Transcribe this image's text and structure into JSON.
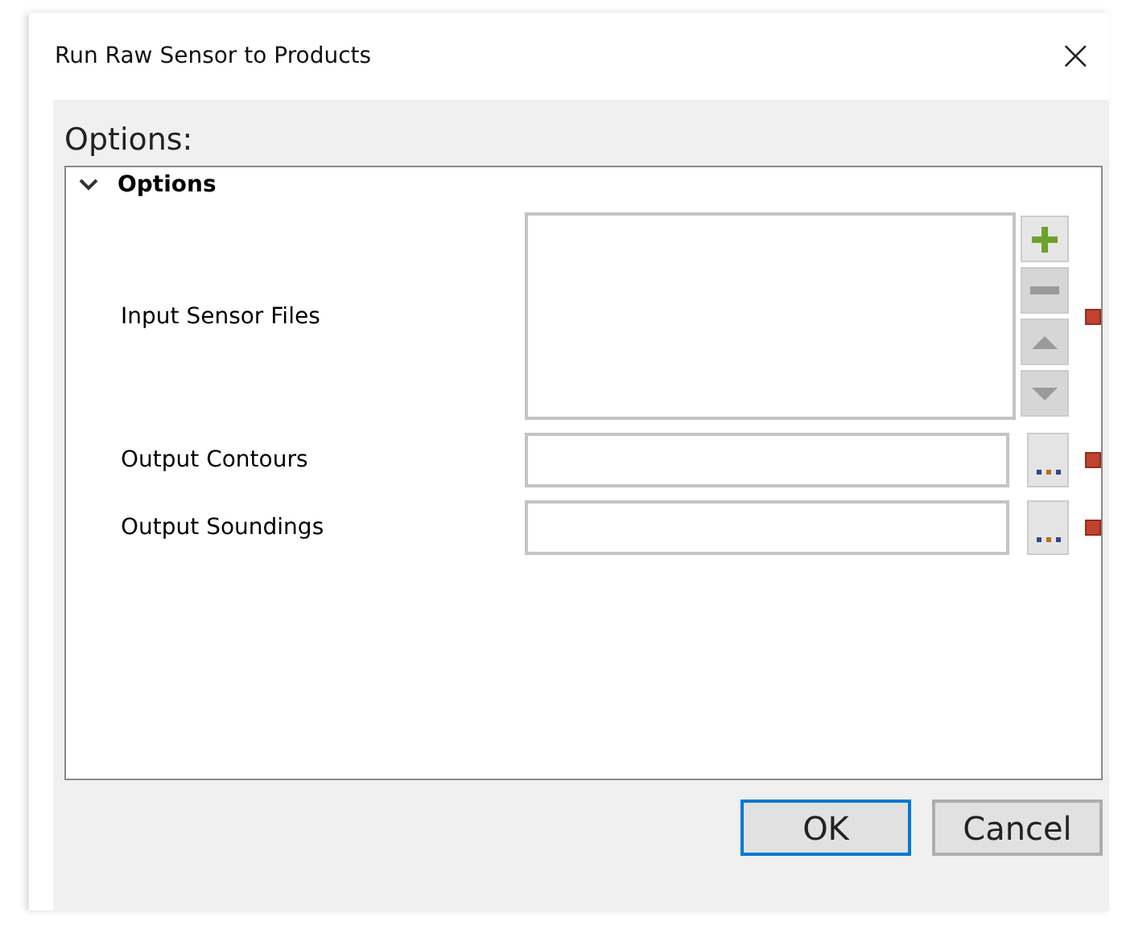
{
  "window": {
    "title": "Run Raw Sensor to Products",
    "close": "×"
  },
  "heading": "Options:",
  "section": {
    "title": "Options",
    "expanded": true,
    "fields": [
      {
        "kind": "list",
        "label": "Input Sensor Files",
        "required": true,
        "list_buttons": [
          {
            "kind": "add",
            "disabled": false
          },
          {
            "kind": "remove",
            "disabled": true
          },
          {
            "kind": "up",
            "disabled": true
          },
          {
            "kind": "down",
            "disabled": true
          }
        ]
      },
      {
        "kind": "file",
        "label": "Output Contours",
        "required": true
      },
      {
        "kind": "file",
        "label": "Output Soundings",
        "required": true
      }
    ]
  },
  "buttons": [
    {
      "label": "OK",
      "default": true
    },
    {
      "label": "Cancel",
      "default": false
    }
  ]
}
